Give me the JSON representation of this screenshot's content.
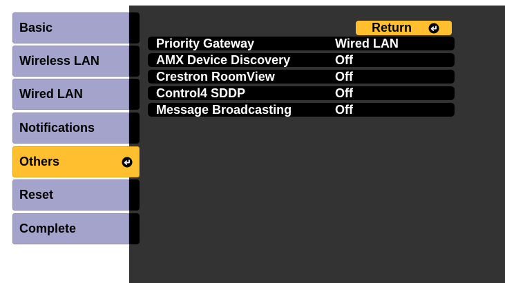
{
  "sidebar": {
    "items": [
      {
        "label": "Basic"
      },
      {
        "label": "Wireless LAN"
      },
      {
        "label": "Wired LAN"
      },
      {
        "label": "Notifications"
      },
      {
        "label": "Others",
        "active": true
      },
      {
        "label": "Reset"
      },
      {
        "label": "Complete"
      }
    ]
  },
  "return_button": {
    "label": "Return",
    "icon": "enter-icon"
  },
  "settings": [
    {
      "label": "Priority Gateway",
      "value": "Wired LAN"
    },
    {
      "label": "AMX Device Discovery",
      "value": "Off"
    },
    {
      "label": "Crestron RoomView",
      "value": "Off"
    },
    {
      "label": "Control4 SDDP",
      "value": "Off"
    },
    {
      "label": "Message Broadcasting",
      "value": "Off"
    }
  ],
  "colors": {
    "tab": "#a4a3cb",
    "active": "#ffbf2e",
    "panel": "#333333",
    "row": "#000000",
    "text_on_dark": "#ffffff"
  }
}
